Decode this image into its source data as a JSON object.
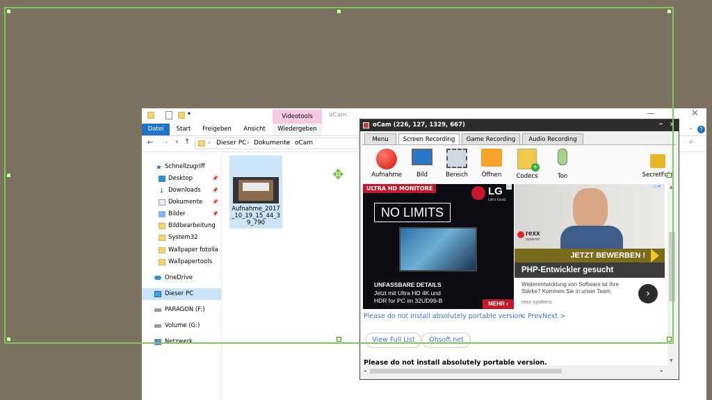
{
  "explorer": {
    "contextual_tab": "Videotools",
    "window_title": "oCam",
    "tabs": [
      "Datei",
      "Start",
      "Freigeben",
      "Ansicht",
      "Wiedergeben"
    ],
    "address": [
      "Dieser PC",
      "Dokumente",
      "oCam"
    ],
    "nav": [
      {
        "label": "Schnellzugriff",
        "icon": "star-icon"
      },
      {
        "label": "Desktop",
        "icon": "desktop-icon",
        "pinned": true
      },
      {
        "label": "Downloads",
        "icon": "download-icon",
        "pinned": true
      },
      {
        "label": "Dokumente",
        "icon": "documents-icon",
        "pinned": true
      },
      {
        "label": "Bilder",
        "icon": "pictures-icon",
        "pinned": true
      },
      {
        "label": "Bildbearbeitung",
        "icon": "folder-icon"
      },
      {
        "label": "System32",
        "icon": "folder-icon"
      },
      {
        "label": "Wallpaper fotolia",
        "icon": "folder-icon"
      },
      {
        "label": "Wallpapertools",
        "icon": "folder-icon"
      },
      {
        "label": "OneDrive",
        "icon": "cloud-icon"
      },
      {
        "label": "Dieser PC",
        "icon": "computer-icon"
      },
      {
        "label": "PARAGON (F:)",
        "icon": "drive-icon"
      },
      {
        "label": "Volume (G:)",
        "icon": "drive-icon"
      },
      {
        "label": "Netzwerk",
        "icon": "network-icon"
      }
    ],
    "file": {
      "name": "Aufnahme_2017_10_19_15_44_39_790"
    }
  },
  "ocam": {
    "title": "oCam (226, 127, 1329, 667)",
    "tabs": [
      "Menu",
      "Screen Recording",
      "Game Recording",
      "Audio Recording"
    ],
    "active_tab": "Screen Recording",
    "tools": [
      "Aufnahme",
      "Bild",
      "Bereich",
      "Öffnen",
      "Codecs",
      "Ton",
      "SecretFold"
    ],
    "ad_left": {
      "banner": "ULTRA HD MONITORE",
      "brand": "LG",
      "brand_tag": "Life's Good",
      "headline": "NO LIMITS",
      "line1": "UNFASSBARE DETAILS",
      "line2": "Jetzt mit Ultra HD 4K und",
      "line3": "HDR for PC im 32UD99-B",
      "cta": "MEHR ›"
    },
    "ad_right": {
      "brand": "rexx",
      "brand_sub": "systems",
      "cta": "JETZT BEWERBEN !",
      "title": "PHP-Entwickler gesucht",
      "body": "Weiterentwicklung von Software ist Ihre Stärke? Kommen Sie in unser Team.",
      "footer": "rexx systems"
    },
    "notice_link": "Please do not install absolutely portable version.",
    "prev": "< Prev",
    "next": "Next >",
    "btn_full_list": "View Full List",
    "btn_site": "Ohsoft.net",
    "notice_bold": "Please do not install absolutely portable version."
  },
  "colors": {
    "desktop": "#7d7262",
    "selection": "#7ec85a",
    "accent_blue": "#1e73c8",
    "lg_red": "#c4182c",
    "rexx_banner": "#7a6a1c"
  }
}
